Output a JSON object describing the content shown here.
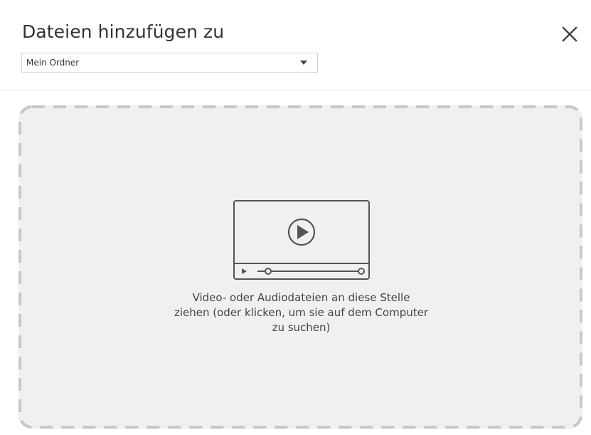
{
  "dialog": {
    "title": "Dateien hinzufügen zu",
    "close_icon": "close-icon"
  },
  "folder_select": {
    "selected": "Mein Ordner",
    "caret_icon": "caret-down-icon"
  },
  "dropzone": {
    "icon": "video-player-icon",
    "text_lines": [
      "Video- oder Audiodateien an diese Stelle",
      "ziehen (oder klicken, um sie auf dem Computer",
      "zu suchen)"
    ]
  },
  "colors": {
    "dropzone_background": "#f0f0f0",
    "dropzone_border": "#c8c8c8",
    "icon_stroke": "#555555",
    "text": "#333333"
  }
}
